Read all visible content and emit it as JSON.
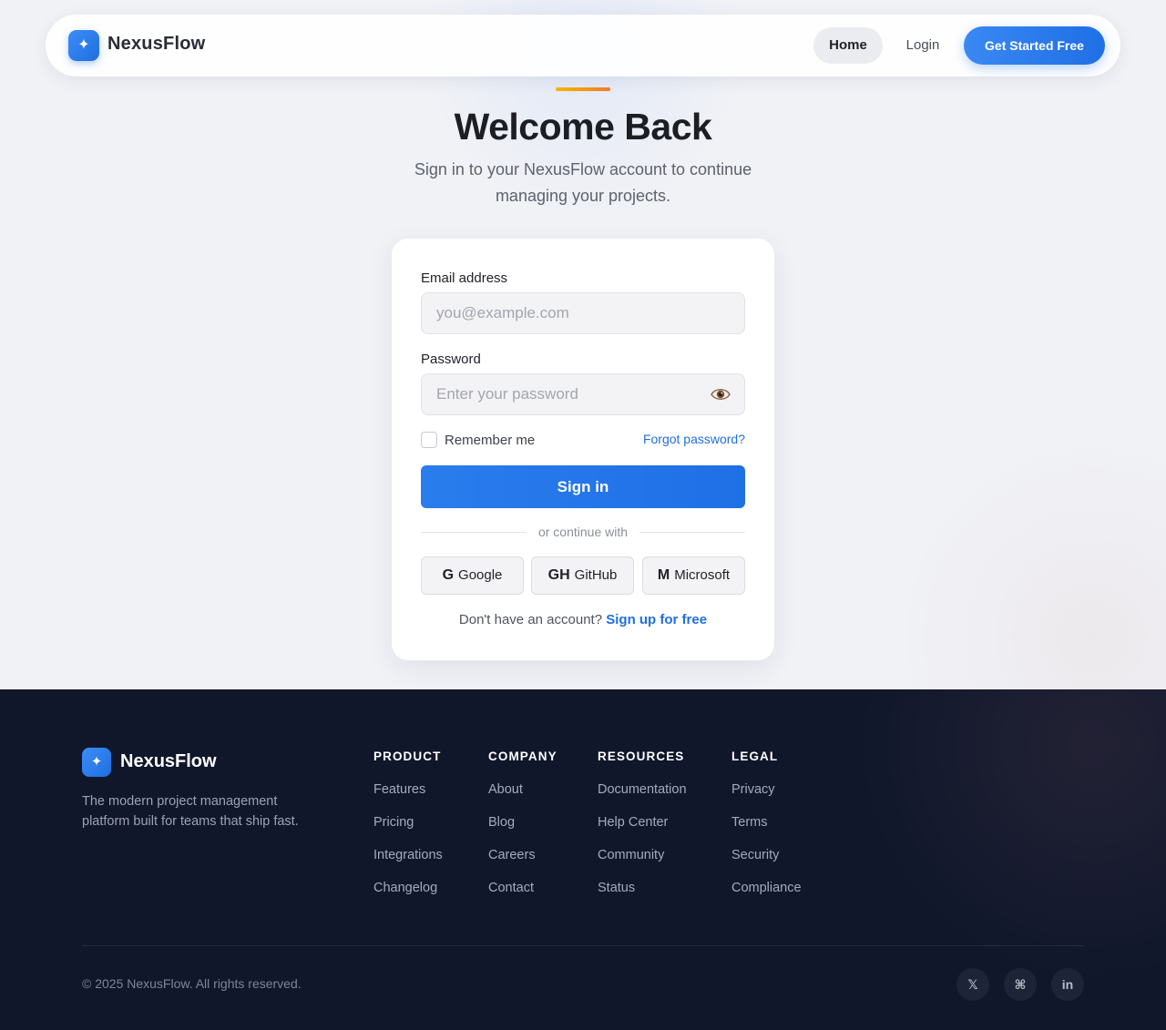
{
  "nav": {
    "logo_glyph": "✦",
    "brand": "NexusFlow",
    "home_label": "Home",
    "login_label": "Login",
    "cta_label": "Get Started Free"
  },
  "hero": {
    "title": "Welcome Back",
    "subtitle": "Sign in to your NexusFlow account to continue managing your projects."
  },
  "form": {
    "email_label": "Email address",
    "email_placeholder": "you@example.com",
    "password_label": "Password",
    "password_placeholder": "Enter your password",
    "remember_label": "Remember me",
    "forgot_label": "Forgot password?",
    "submit_label": "Sign in",
    "divider_text": "or continue with",
    "social": [
      {
        "glyph": "G",
        "label": "Google"
      },
      {
        "glyph": "GH",
        "label": "GitHub"
      },
      {
        "glyph": "M",
        "label": "Microsoft"
      }
    ],
    "signup_prompt": "Don't have an account?",
    "signup_link": "Sign up for free"
  },
  "footer": {
    "logo_glyph": "✦",
    "brand": "NexusFlow",
    "tagline": "The modern project management platform built for teams that ship fast.",
    "columns": [
      {
        "heading": "PRODUCT",
        "links": [
          "Features",
          "Pricing",
          "Integrations",
          "Changelog"
        ]
      },
      {
        "heading": "COMPANY",
        "links": [
          "About",
          "Blog",
          "Careers",
          "Contact"
        ]
      },
      {
        "heading": "RESOURCES",
        "links": [
          "Documentation",
          "Help Center",
          "Community",
          "Status"
        ]
      },
      {
        "heading": "LEGAL",
        "links": [
          "Privacy",
          "Terms",
          "Security",
          "Compliance"
        ]
      }
    ],
    "copyright": "© 2025 NexusFlow. All rights reserved.",
    "social": [
      {
        "glyph": "𝕏",
        "name": "x-icon"
      },
      {
        "glyph": "⌘",
        "name": "command-icon"
      },
      {
        "glyph": "in",
        "name": "linkedin-icon"
      }
    ]
  },
  "colors": {
    "primary": "#1f6fe6",
    "accent_start": "#f8b400",
    "accent_end": "#f07a2a",
    "footer_bg": "#10172b"
  }
}
